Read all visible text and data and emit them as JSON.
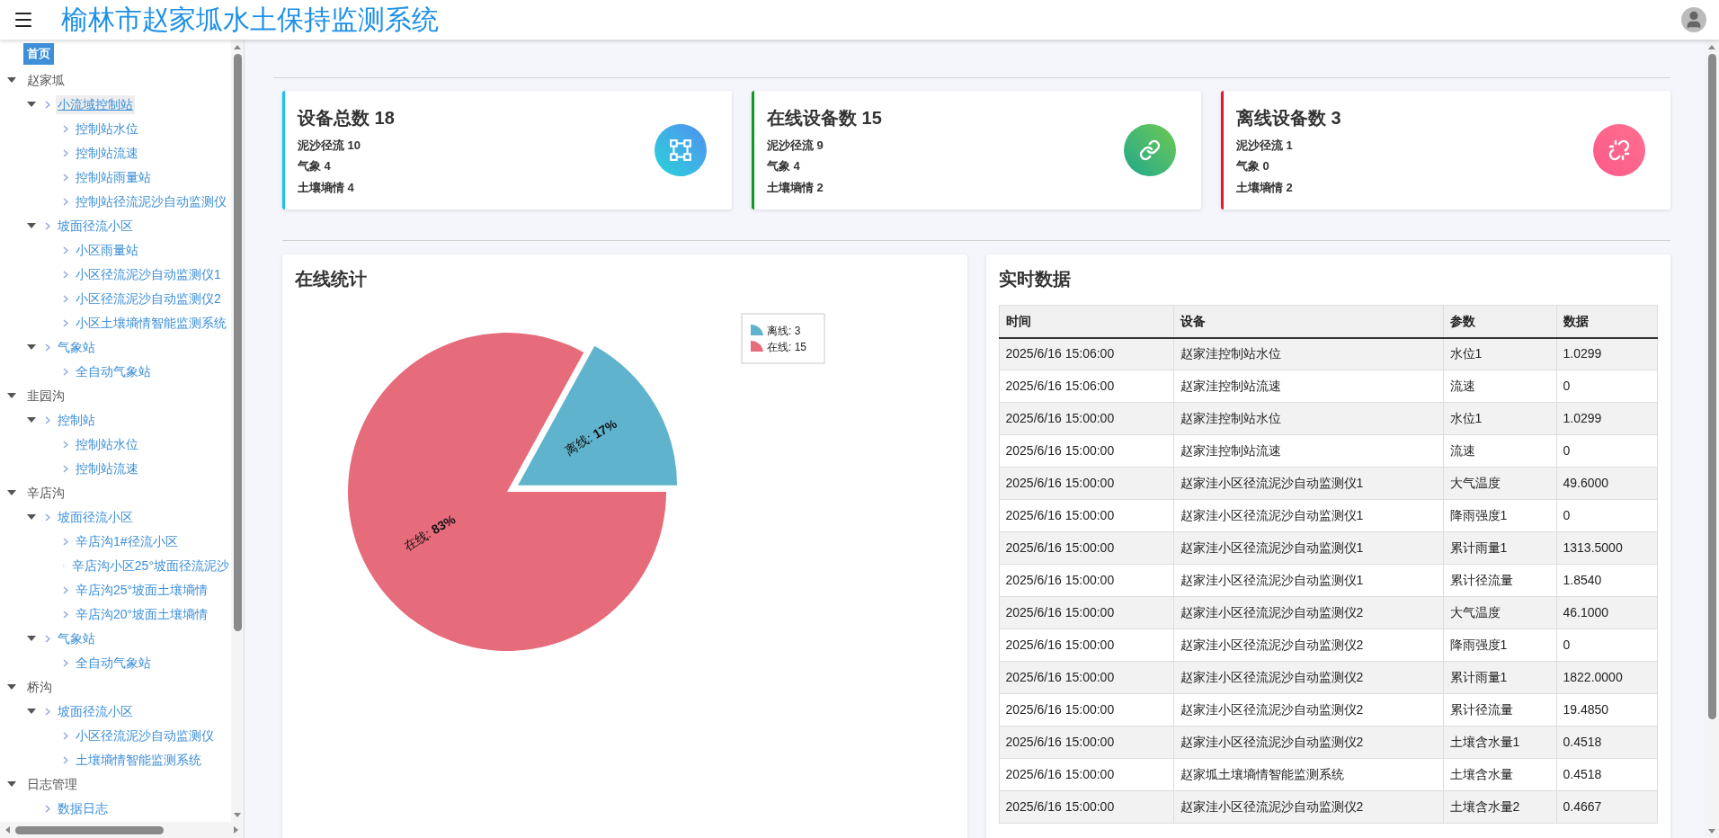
{
  "header": {
    "title": "榆林市赵家坬水土保持监测系统"
  },
  "sidebar": {
    "home": {
      "label": "首页",
      "selected": true
    },
    "tree": [
      {
        "label": "赵家坬",
        "expanded": true,
        "selected": false,
        "children": [
          {
            "label": "小流域控制站",
            "expanded": true,
            "selected": true,
            "children": [
              {
                "label": "控制站水位",
                "selected": false
              },
              {
                "label": "控制站流速",
                "selected": false
              },
              {
                "label": "控制站雨量站",
                "selected": false
              },
              {
                "label": "控制站径流泥沙自动监测仪",
                "selected": false
              }
            ]
          },
          {
            "label": "坡面径流小区",
            "expanded": true,
            "selected": false,
            "children": [
              {
                "label": "小区雨量站",
                "selected": false
              },
              {
                "label": "小区径流泥沙自动监测仪1",
                "selected": false
              },
              {
                "label": "小区径流泥沙自动监测仪2",
                "selected": false
              },
              {
                "label": "小区土壤墒情智能监测系统",
                "selected": false
              }
            ]
          },
          {
            "label": "气象站",
            "expanded": true,
            "selected": false,
            "children": [
              {
                "label": "全自动气象站",
                "selected": false
              }
            ]
          }
        ]
      },
      {
        "label": "韭园沟",
        "expanded": true,
        "selected": false,
        "children": [
          {
            "label": "控制站",
            "expanded": true,
            "selected": false,
            "children": [
              {
                "label": "控制站水位",
                "selected": false
              },
              {
                "label": "控制站流速",
                "selected": false
              }
            ]
          }
        ]
      },
      {
        "label": "辛店沟",
        "expanded": true,
        "selected": false,
        "children": [
          {
            "label": "坡面径流小区",
            "expanded": true,
            "selected": false,
            "children": [
              {
                "label": "辛店沟1#径流小区",
                "selected": false
              },
              {
                "label": "辛店沟小区25°坡面径流泥沙",
                "selected": false
              },
              {
                "label": "辛店沟25°坡面土壤墒情",
                "selected": false
              },
              {
                "label": "辛店沟20°坡面土壤墒情",
                "selected": false
              }
            ]
          },
          {
            "label": "气象站",
            "expanded": true,
            "selected": false,
            "children": [
              {
                "label": "全自动气象站",
                "selected": false
              }
            ]
          }
        ]
      },
      {
        "label": "桥沟",
        "expanded": true,
        "selected": false,
        "children": [
          {
            "label": "坡面径流小区",
            "expanded": true,
            "selected": false,
            "children": [
              {
                "label": "小区径流泥沙自动监测仪",
                "selected": false
              },
              {
                "label": "土壤墒情智能监测系统",
                "selected": false
              }
            ]
          }
        ]
      },
      {
        "label": "日志管理",
        "expanded": true,
        "selected": false,
        "children": [
          {
            "label": "数据日志",
            "selected": false
          }
        ]
      }
    ]
  },
  "stats_cards": [
    {
      "kind": "total",
      "title": "设备总数 18",
      "color": "#18c2ec",
      "lines": [
        "泥沙径流 10",
        "气象 4",
        "土壤墒情 4"
      ]
    },
    {
      "kind": "online",
      "title": "在线设备数 15",
      "color": "#0d9a1f",
      "lines": [
        "泥沙径流 9",
        "气象 4",
        "土壤墒情 2"
      ]
    },
    {
      "kind": "offline",
      "title": "离线设备数 3",
      "color": "#e8142c",
      "lines": [
        "泥沙径流 1",
        "气象 0",
        "土壤墒情 2"
      ]
    }
  ],
  "online_panel": {
    "title": "在线统计",
    "label_separator": ": ",
    "slices": [
      {
        "color": "#5fb3cc",
        "exploded": true
      },
      {
        "color": "#e66b7b",
        "exploded": false
      }
    ],
    "legend_items": [
      {
        "label": "离线: 3",
        "color": "#5fb3cc"
      },
      {
        "label": "在线: 15",
        "color": "#e66b7b"
      }
    ],
    "chart_data": {
      "type": "pie",
      "categories": [
        "离线",
        "在线"
      ],
      "series": [
        {
          "values": [
            17,
            83
          ]
        }
      ],
      "value_labels": [
        "17%",
        "83%"
      ]
    }
  },
  "realtime_panel": {
    "title": "实时数据",
    "columns": [
      "时间",
      "设备",
      "参数",
      "数据"
    ],
    "rows": [
      [
        "2025/6/16 15:06:00",
        "赵家洼控制站水位",
        "水位1",
        "1.0299"
      ],
      [
        "2025/6/16 15:06:00",
        "赵家洼控制站流速",
        "流速",
        "0"
      ],
      [
        "2025/6/16 15:00:00",
        "赵家洼控制站水位",
        "水位1",
        "1.0299"
      ],
      [
        "2025/6/16 15:00:00",
        "赵家洼控制站流速",
        "流速",
        "0"
      ],
      [
        "2025/6/16 15:00:00",
        "赵家洼小区径流泥沙自动监测仪1",
        "大气温度",
        "49.6000"
      ],
      [
        "2025/6/16 15:00:00",
        "赵家洼小区径流泥沙自动监测仪1",
        "降雨强度1",
        "0"
      ],
      [
        "2025/6/16 15:00:00",
        "赵家洼小区径流泥沙自动监测仪1",
        "累计雨量1",
        "1313.5000"
      ],
      [
        "2025/6/16 15:00:00",
        "赵家洼小区径流泥沙自动监测仪1",
        "累计径流量",
        "1.8540"
      ],
      [
        "2025/6/16 15:00:00",
        "赵家洼小区径流泥沙自动监测仪2",
        "大气温度",
        "46.1000"
      ],
      [
        "2025/6/16 15:00:00",
        "赵家洼小区径流泥沙自动监测仪2",
        "降雨强度1",
        "0"
      ],
      [
        "2025/6/16 15:00:00",
        "赵家洼小区径流泥沙自动监测仪2",
        "累计雨量1",
        "1822.0000"
      ],
      [
        "2025/6/16 15:00:00",
        "赵家洼小区径流泥沙自动监测仪2",
        "累计径流量",
        "19.4850"
      ],
      [
        "2025/6/16 15:00:00",
        "赵家洼小区径流泥沙自动监测仪2",
        "土壤含水量1",
        "0.4518"
      ],
      [
        "2025/6/16 15:00:00",
        "赵家坬土壤墒情智能监测系统",
        "土壤含水量",
        "0.4518"
      ],
      [
        "2025/6/16 15:00:00",
        "赵家洼小区径流泥沙自动监测仪2",
        "土壤含水量2",
        "0.4667"
      ]
    ]
  }
}
